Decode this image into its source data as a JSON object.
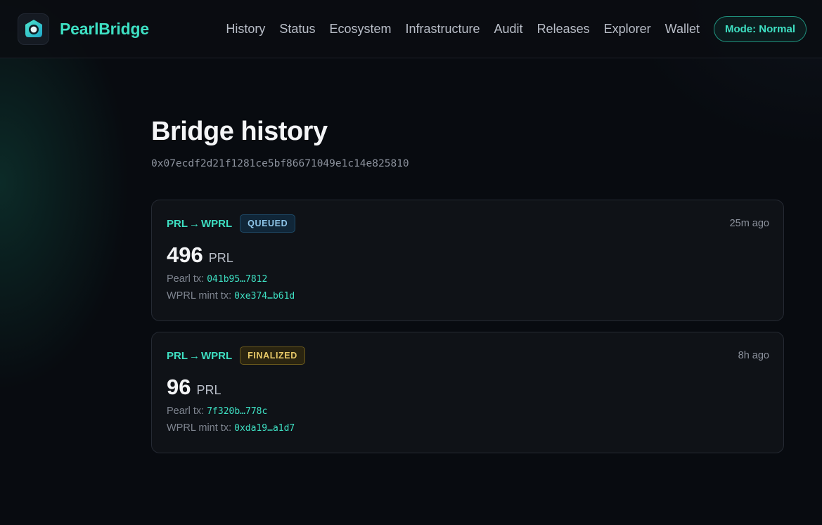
{
  "brand": {
    "name": "PearlBridge",
    "logo_icon": "pearl-logo-icon"
  },
  "nav": {
    "links": [
      "History",
      "Status",
      "Ecosystem",
      "Infrastructure",
      "Audit",
      "Releases",
      "Explorer",
      "Wallet"
    ],
    "mode_label": "Mode: Normal"
  },
  "page": {
    "title": "Bridge history",
    "address": "0x07ecdf2d21f1281ce5bf86671049e1c14e825810"
  },
  "transfers": [
    {
      "from": "PRL",
      "to": "WPRL",
      "arrow": "→",
      "status": "QUEUED",
      "time_ago": "25m ago",
      "amount": "496",
      "unit": "PRL",
      "pearl_tx_label": "Pearl tx:",
      "pearl_tx": "041b95…7812",
      "mint_tx_label": "WPRL mint tx:",
      "mint_tx": "0xe374…b61d"
    },
    {
      "from": "PRL",
      "to": "WPRL",
      "arrow": "→",
      "status": "FINALIZED",
      "time_ago": "8h ago",
      "amount": "96",
      "unit": "PRL",
      "pearl_tx_label": "Pearl tx:",
      "pearl_tx": "7f320b…778c",
      "mint_tx_label": "WPRL mint tx:",
      "mint_tx": "0xda19…a1d7"
    }
  ],
  "colors": {
    "accent": "#3ee0c3",
    "queued": "#8fc6ea",
    "finalized": "#e8c968"
  }
}
